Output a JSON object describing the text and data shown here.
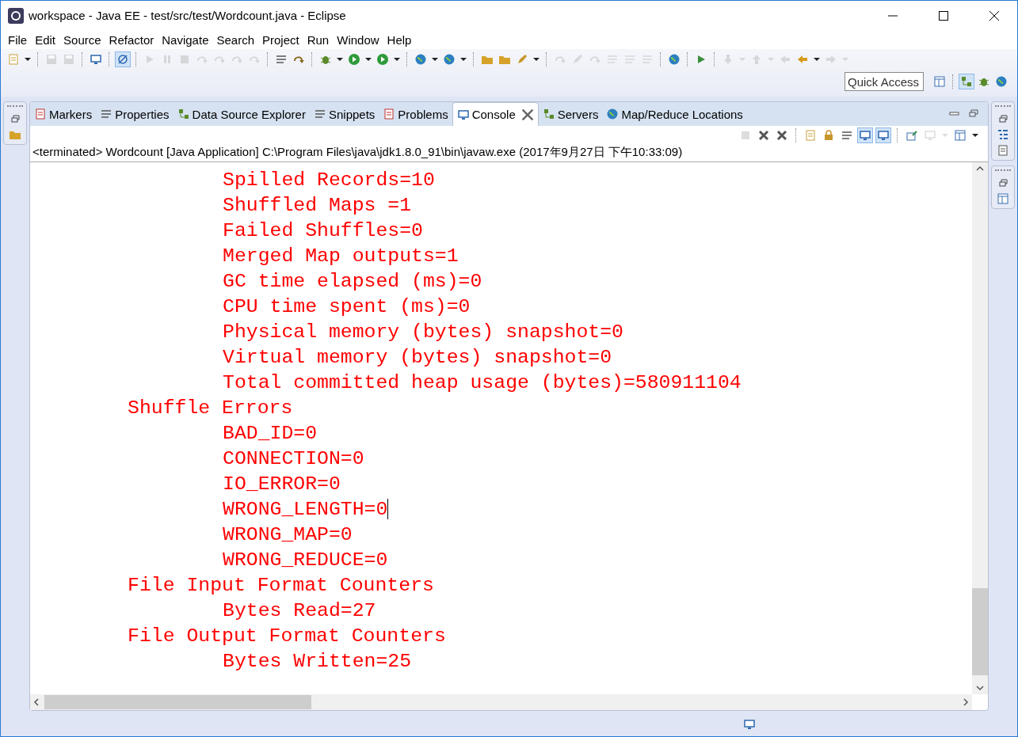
{
  "window": {
    "title": "workspace - Java EE - test/src/test/Wordcount.java - Eclipse"
  },
  "menu": [
    "File",
    "Edit",
    "Source",
    "Refactor",
    "Navigate",
    "Search",
    "Project",
    "Run",
    "Window",
    "Help"
  ],
  "main_toolbar": [
    {
      "kind": "document",
      "pressed": false,
      "disabled": false
    },
    {
      "kind": "dropdown",
      "pressed": false,
      "disabled": false
    },
    {
      "kind": "separator"
    },
    {
      "kind": "save",
      "pressed": false,
      "disabled": true
    },
    {
      "kind": "save",
      "pressed": false,
      "disabled": true
    },
    {
      "kind": "separator"
    },
    {
      "kind": "monitor",
      "pressed": false,
      "disabled": false
    },
    {
      "kind": "separator"
    },
    {
      "kind": "slash",
      "pressed": true,
      "disabled": false
    },
    {
      "kind": "separator"
    },
    {
      "kind": "play",
      "pressed": false,
      "disabled": true
    },
    {
      "kind": "pause",
      "pressed": false,
      "disabled": true
    },
    {
      "kind": "stop",
      "pressed": false,
      "disabled": true
    },
    {
      "kind": "step",
      "pressed": false,
      "disabled": true
    },
    {
      "kind": "step",
      "pressed": false,
      "disabled": true
    },
    {
      "kind": "step",
      "pressed": false,
      "disabled": true
    },
    {
      "kind": "step",
      "pressed": false,
      "disabled": true
    },
    {
      "kind": "separator"
    },
    {
      "kind": "lines",
      "pressed": false,
      "disabled": false
    },
    {
      "kind": "step",
      "pressed": false,
      "disabled": false
    },
    {
      "kind": "separator"
    },
    {
      "kind": "bug",
      "pressed": false,
      "disabled": false
    },
    {
      "kind": "dropdown",
      "pressed": false,
      "disabled": false
    },
    {
      "kind": "run",
      "pressed": false,
      "disabled": false
    },
    {
      "kind": "dropdown",
      "pressed": false,
      "disabled": false
    },
    {
      "kind": "run",
      "pressed": false,
      "disabled": false
    },
    {
      "kind": "dropdown",
      "pressed": false,
      "disabled": false
    },
    {
      "kind": "separator"
    },
    {
      "kind": "globe",
      "pressed": false,
      "disabled": false
    },
    {
      "kind": "dropdown",
      "pressed": false,
      "disabled": false
    },
    {
      "kind": "globe",
      "pressed": false,
      "disabled": false
    },
    {
      "kind": "dropdown",
      "pressed": false,
      "disabled": false
    },
    {
      "kind": "separator"
    },
    {
      "kind": "folder",
      "pressed": false,
      "disabled": false
    },
    {
      "kind": "folder",
      "pressed": false,
      "disabled": false
    },
    {
      "kind": "pen",
      "pressed": false,
      "disabled": false
    },
    {
      "kind": "dropdown",
      "pressed": false,
      "disabled": false
    },
    {
      "kind": "separator"
    },
    {
      "kind": "step",
      "pressed": false,
      "disabled": true
    },
    {
      "kind": "pen",
      "pressed": false,
      "disabled": true
    },
    {
      "kind": "step",
      "pressed": false,
      "disabled": true
    },
    {
      "kind": "lines",
      "pressed": false,
      "disabled": true
    },
    {
      "kind": "lines",
      "pressed": false,
      "disabled": true
    },
    {
      "kind": "lines",
      "pressed": false,
      "disabled": true
    },
    {
      "kind": "separator"
    },
    {
      "kind": "globe",
      "pressed": false,
      "disabled": false
    },
    {
      "kind": "separator"
    },
    {
      "kind": "play",
      "pressed": false,
      "disabled": false
    },
    {
      "kind": "separator"
    },
    {
      "kind": "arrow-down",
      "pressed": false,
      "disabled": true
    },
    {
      "kind": "dropdown",
      "pressed": false,
      "disabled": true
    },
    {
      "kind": "arrow-up",
      "pressed": false,
      "disabled": true
    },
    {
      "kind": "dropdown",
      "pressed": false,
      "disabled": true
    },
    {
      "kind": "arrow-left",
      "pressed": false,
      "disabled": true
    },
    {
      "kind": "arrow-left",
      "pressed": false,
      "disabled": false
    },
    {
      "kind": "dropdown",
      "pressed": false,
      "disabled": false
    },
    {
      "kind": "arrow-right",
      "pressed": false,
      "disabled": true
    },
    {
      "kind": "dropdown",
      "pressed": false,
      "disabled": true
    }
  ],
  "quick_access": {
    "placeholder": "Quick Access"
  },
  "perspectives": [
    {
      "kind": "window",
      "pressed": false,
      "disabled": false
    },
    {
      "kind": "separator"
    },
    {
      "kind": "grid",
      "pressed": true,
      "disabled": false
    },
    {
      "kind": "bug",
      "pressed": false,
      "disabled": false
    },
    {
      "kind": "globe",
      "pressed": false,
      "disabled": false
    }
  ],
  "tabs": [
    {
      "label": "Markers",
      "kind": "doc",
      "selected": false
    },
    {
      "label": "Properties",
      "kind": "lines",
      "selected": false
    },
    {
      "label": "Data Source Explorer",
      "kind": "grid",
      "selected": false
    },
    {
      "label": "Snippets",
      "kind": "lines",
      "selected": false
    },
    {
      "label": "Problems",
      "kind": "doc",
      "selected": false
    },
    {
      "label": "Console",
      "kind": "monitor",
      "selected": true
    },
    {
      "label": "Servers",
      "kind": "grid",
      "selected": false
    },
    {
      "label": "Map/Reduce Locations",
      "kind": "globe",
      "selected": false
    }
  ],
  "console_toolbar": [
    {
      "kind": "stop",
      "pressed": false,
      "disabled": true
    },
    {
      "kind": "cross",
      "pressed": false,
      "disabled": false
    },
    {
      "kind": "cross",
      "pressed": false,
      "disabled": false
    },
    {
      "kind": "separator"
    },
    {
      "kind": "document",
      "pressed": false,
      "disabled": false
    },
    {
      "kind": "lock",
      "pressed": false,
      "disabled": false
    },
    {
      "kind": "lines",
      "pressed": false,
      "disabled": false
    },
    {
      "kind": "monitor",
      "pressed": true,
      "disabled": false
    },
    {
      "kind": "monitor",
      "pressed": true,
      "disabled": false
    },
    {
      "kind": "separator"
    },
    {
      "kind": "pin",
      "pressed": false,
      "disabled": false
    },
    {
      "kind": "monitor",
      "pressed": false,
      "disabled": true
    },
    {
      "kind": "dropdown",
      "pressed": false,
      "disabled": true
    },
    {
      "kind": "window",
      "pressed": false,
      "disabled": false
    },
    {
      "kind": "dropdown",
      "pressed": false,
      "disabled": false
    }
  ],
  "console": {
    "header": "<terminated> Wordcount [Java Application] C:\\Program Files\\java\\jdk1.8.0_91\\bin\\javaw.exe (2017年9月27日 下午10:33:09)",
    "output_tail": [
      "Spilled Records=10",
      "Shuffled Maps =1",
      "Failed Shuffles=0",
      "Merged Map outputs=1",
      "GC time elapsed (ms)=0",
      "CPU time spent (ms)=0",
      "Physical memory (bytes) snapshot=0",
      "Virtual memory (bytes) snapshot=0",
      "Total committed heap usage (bytes)=580911104"
    ],
    "groups": [
      {
        "text": "Shuffle Errors",
        "children": [
          {
            "text": "BAD_ID=0",
            "cursor": false
          },
          {
            "text": "CONNECTION=0",
            "cursor": false
          },
          {
            "text": "IO_ERROR=0",
            "cursor": false
          },
          {
            "text": "WRONG_LENGTH=0",
            "cursor": true
          },
          {
            "text": "WRONG_MAP=0",
            "cursor": false
          },
          {
            "text": "WRONG_REDUCE=0",
            "cursor": false
          }
        ]
      },
      {
        "text": "File Input Format Counters",
        "children": [
          {
            "text": "Bytes Read=27",
            "cursor": false
          }
        ]
      },
      {
        "text": "File Output Format Counters",
        "children": [
          {
            "text": "Bytes Written=25",
            "cursor": false
          }
        ]
      }
    ]
  }
}
